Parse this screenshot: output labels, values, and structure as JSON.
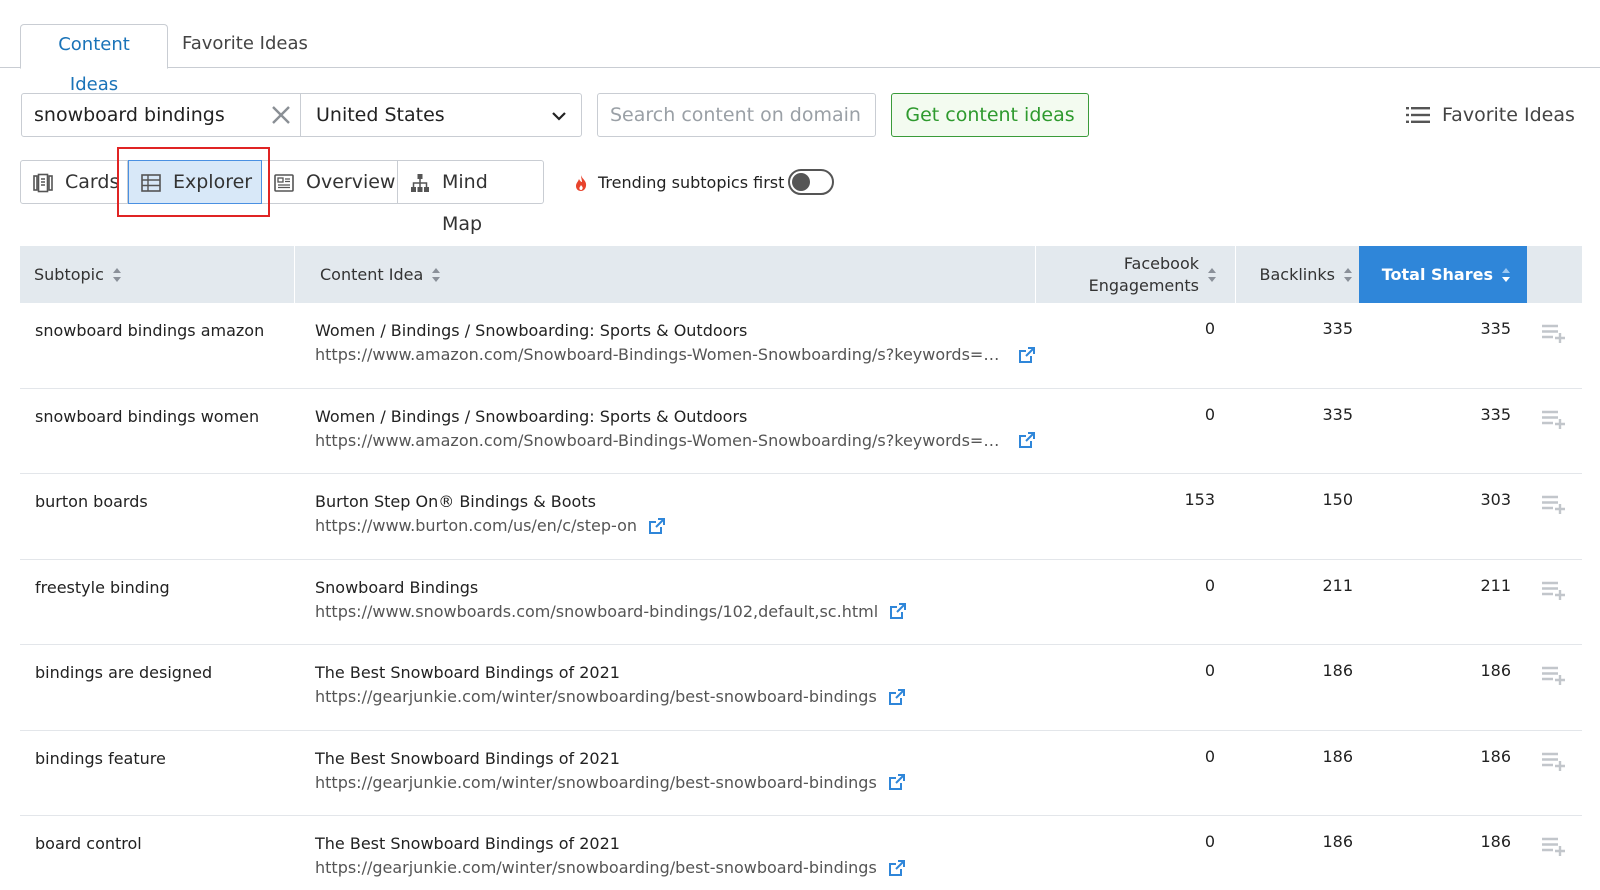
{
  "tabs": [
    {
      "label": "Content Ideas",
      "active": true
    },
    {
      "label": "Favorite Ideas",
      "active": false
    }
  ],
  "search": {
    "keyword": "snowboard bindings",
    "country": "United States",
    "domain_placeholder": "Search content on domain",
    "submit_label": "Get content ideas",
    "favorites_label": "Favorite Ideas"
  },
  "views": {
    "cards": "Cards",
    "explorer": "Explorer",
    "overview": "Overview",
    "mindmap": "Mind Map",
    "selected": "Explorer"
  },
  "trending": {
    "label": "Trending subtopics first",
    "enabled": false
  },
  "table": {
    "headers": {
      "subtopic": "Subtopic",
      "content_idea": "Content Idea",
      "facebook_1": "Facebook",
      "facebook_2": "Engagements",
      "backlinks": "Backlinks",
      "total_shares": "Total Shares"
    },
    "rows": [
      {
        "subtopic": "snowboard bindings amazon",
        "title": "Women / Bindings / Snowboarding: Sports & Outdoors",
        "url": "https://www.amazon.com/Snowboard-Bindings-Women-Snowboarding/s?keywords=Sn...",
        "facebook": "0",
        "backlinks": "335",
        "total": "335"
      },
      {
        "subtopic": "snowboard bindings women",
        "title": "Women / Bindings / Snowboarding: Sports & Outdoors",
        "url": "https://www.amazon.com/Snowboard-Bindings-Women-Snowboarding/s?keywords=Sn...",
        "facebook": "0",
        "backlinks": "335",
        "total": "335"
      },
      {
        "subtopic": "burton boards",
        "title": "Burton Step On® Bindings & Boots",
        "url": "https://www.burton.com/us/en/c/step-on",
        "facebook": "153",
        "backlinks": "150",
        "total": "303"
      },
      {
        "subtopic": "freestyle binding",
        "title": "Snowboard Bindings",
        "url": "https://www.snowboards.com/snowboard-bindings/102,default,sc.html",
        "facebook": "0",
        "backlinks": "211",
        "total": "211"
      },
      {
        "subtopic": "bindings are designed",
        "title": "The Best Snowboard Bindings of 2021",
        "url": "https://gearjunkie.com/winter/snowboarding/best-snowboard-bindings",
        "facebook": "0",
        "backlinks": "186",
        "total": "186"
      },
      {
        "subtopic": "bindings feature",
        "title": "The Best Snowboard Bindings of 2021",
        "url": "https://gearjunkie.com/winter/snowboarding/best-snowboard-bindings",
        "facebook": "0",
        "backlinks": "186",
        "total": "186"
      },
      {
        "subtopic": "board control",
        "title": "The Best Snowboard Bindings of 2021",
        "url": "https://gearjunkie.com/winter/snowboarding/best-snowboard-bindings",
        "facebook": "0",
        "backlinks": "186",
        "total": "186"
      }
    ]
  },
  "icons": {
    "clear": "close-icon",
    "dropdown": "chevron-down-icon",
    "favorites": "list-icon",
    "cards": "cards-icon",
    "explorer": "table-icon",
    "overview": "overview-icon",
    "mindmap": "mind-map-icon",
    "trending": "flame-icon",
    "external": "external-link-icon",
    "add": "add-to-list-icon"
  },
  "colors": {
    "accent": "#2f86d9",
    "tab_active": "#1a73b8",
    "submit": "#2e9a2e",
    "highlight": "#e02424",
    "flame": "#e8432c"
  }
}
